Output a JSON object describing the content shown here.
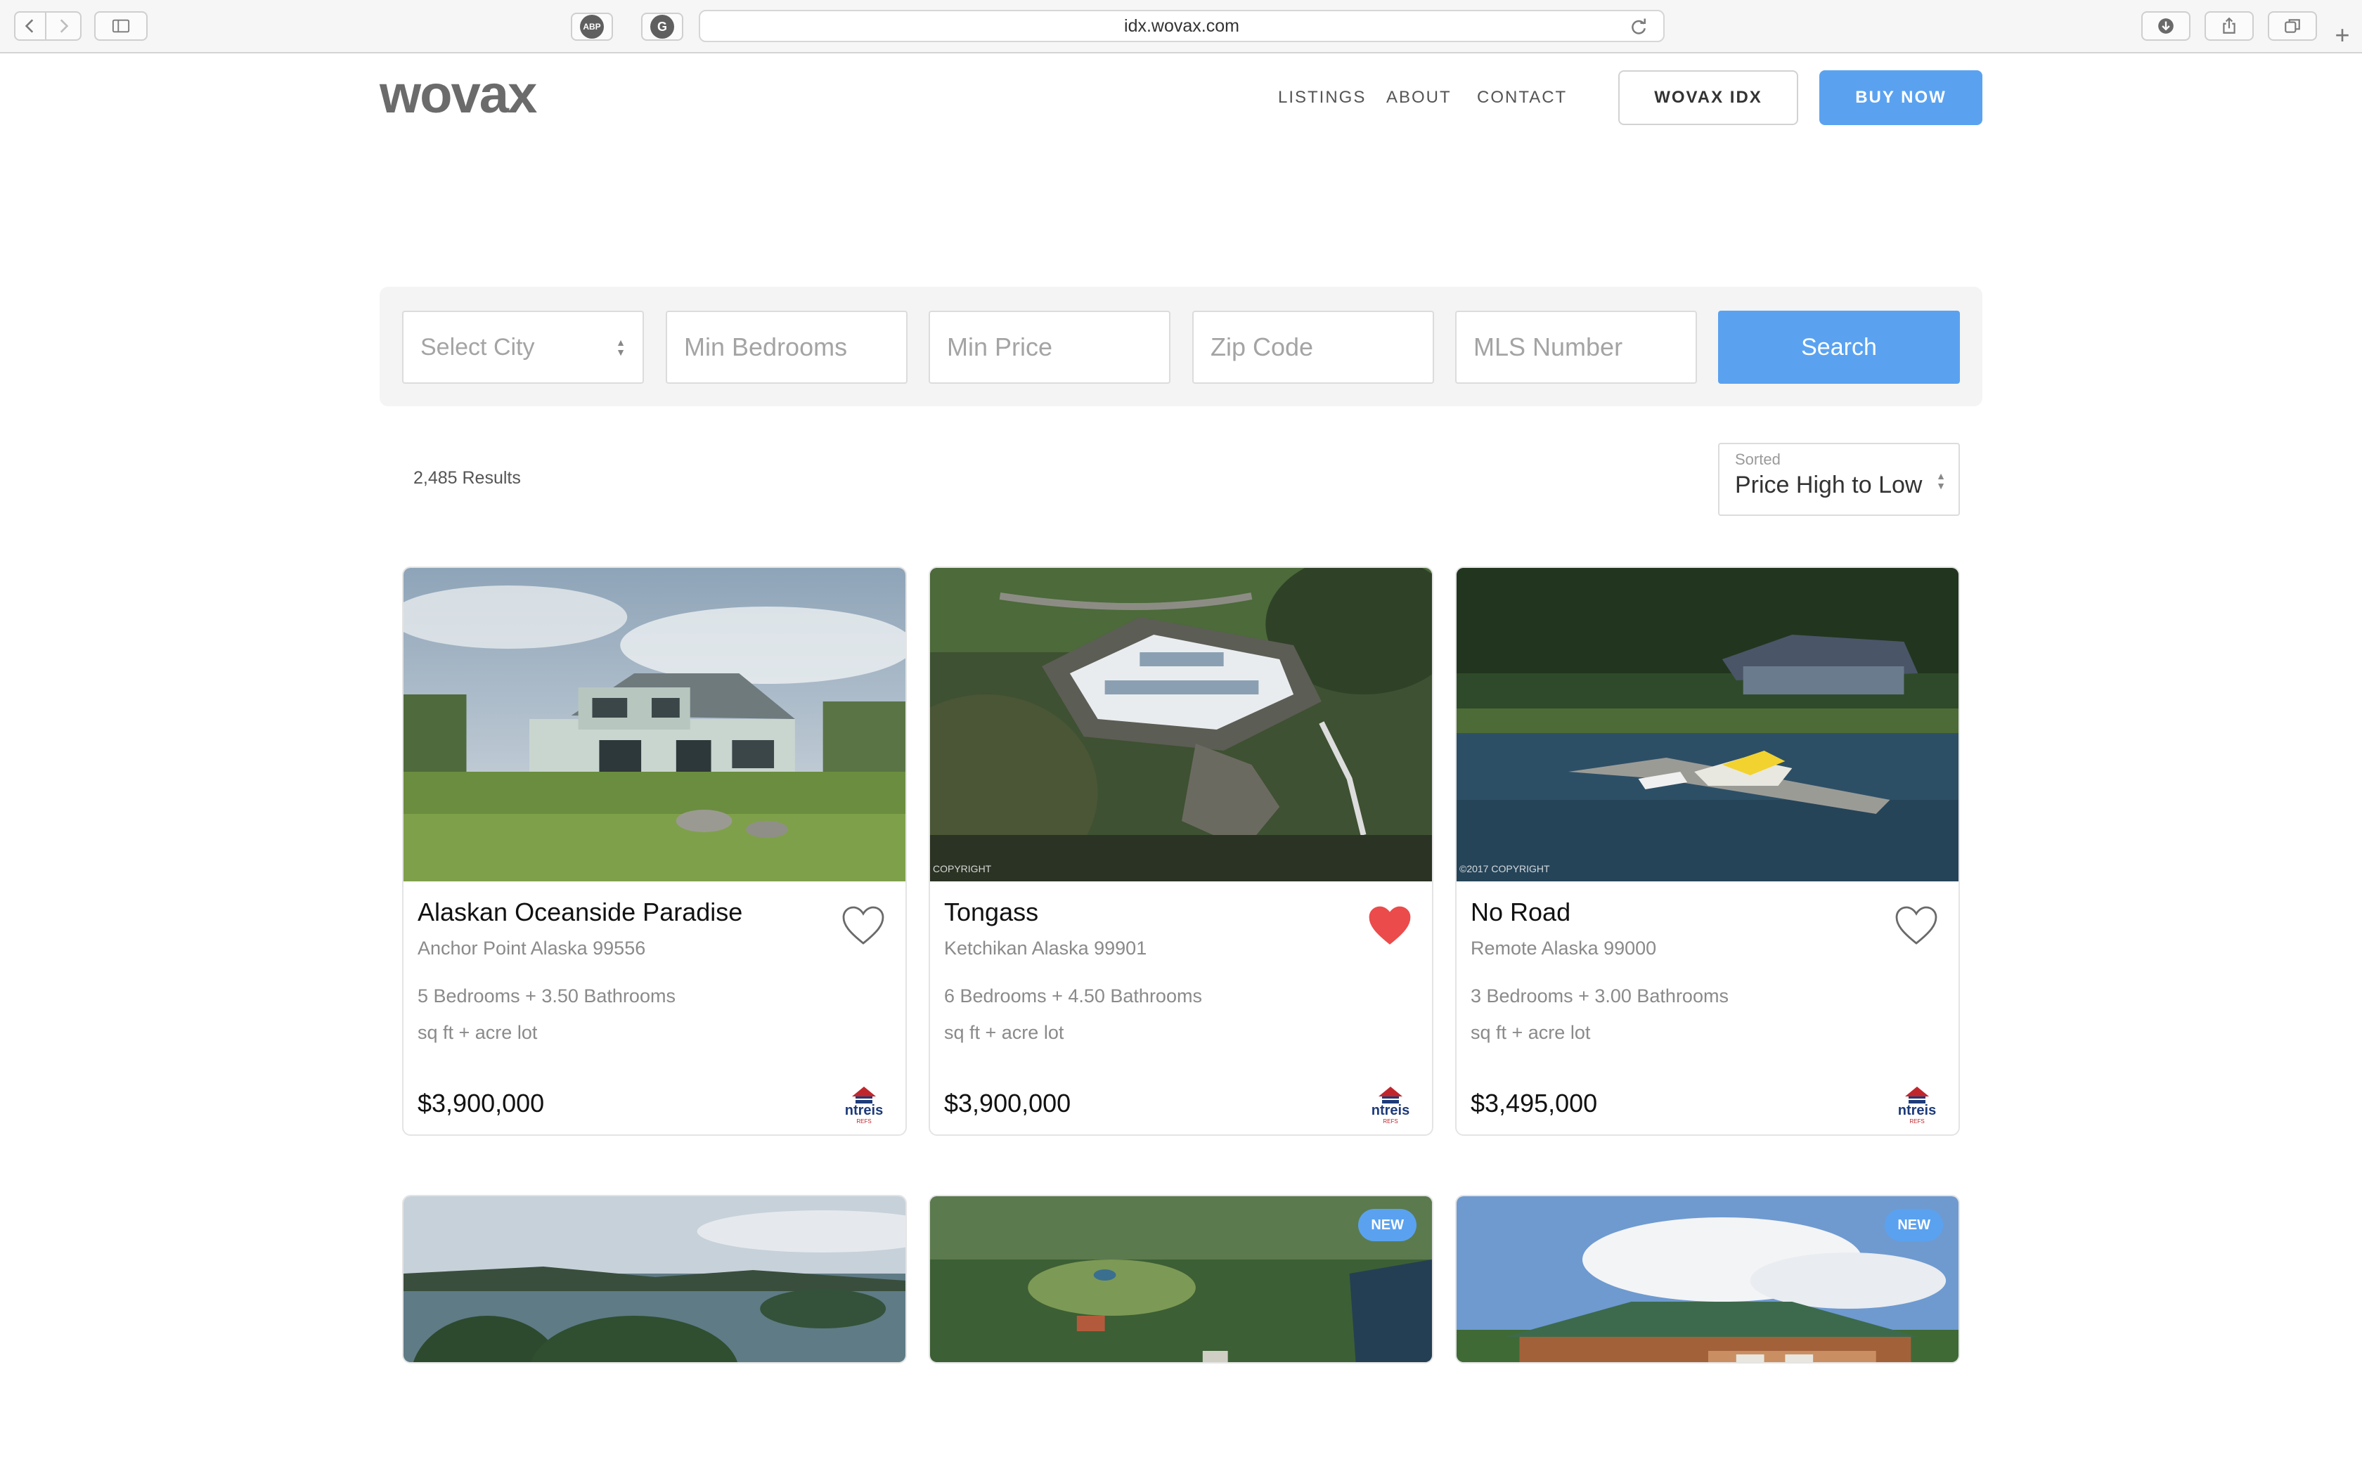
{
  "browser": {
    "url": "idx.wovax.com",
    "extensions": [
      "ABP",
      "G"
    ]
  },
  "header": {
    "logo": "wovax",
    "nav": [
      "LISTINGS",
      "ABOUT",
      "CONTACT"
    ],
    "idx_button": "WOVAX IDX",
    "buy_button": "BUY NOW",
    "accent_color": "#5aa2f0"
  },
  "search": {
    "city_placeholder": "Select City",
    "bedrooms_placeholder": "Min Bedrooms",
    "price_placeholder": "Min Price",
    "zip_placeholder": "Zip Code",
    "mls_placeholder": "MLS Number",
    "button": "Search"
  },
  "results": {
    "count_label": "2,485 Results",
    "sort_label": "Sorted",
    "sort_value": "Price High to Low"
  },
  "listings": [
    {
      "title": "Alaskan Oceanside Paradise",
      "address": "Anchor Point Alaska 99556",
      "details": "5 Bedrooms + 3.50 Bathrooms",
      "lot": "sq ft + acre lot",
      "price": "$3,900,000",
      "favorited": false,
      "mls_logo": "ntreis"
    },
    {
      "title": "Tongass",
      "address": "Ketchikan Alaska 99901",
      "details": "6 Bedrooms + 4.50 Bathrooms",
      "lot": "sq ft + acre lot",
      "price": "$3,900,000",
      "favorited": true,
      "photo_watermark": "COPYRIGHT",
      "mls_logo": "ntreis"
    },
    {
      "title": "No Road",
      "address": "Remote Alaska 99000",
      "details": "3 Bedrooms + 3.00 Bathrooms",
      "lot": "sq ft + acre lot",
      "price": "$3,495,000",
      "favorited": false,
      "photo_watermark": "©2017 COPYRIGHT",
      "mls_logo": "ntreis"
    },
    {
      "badge": ""
    },
    {
      "badge": "NEW"
    },
    {
      "badge": "NEW"
    }
  ]
}
